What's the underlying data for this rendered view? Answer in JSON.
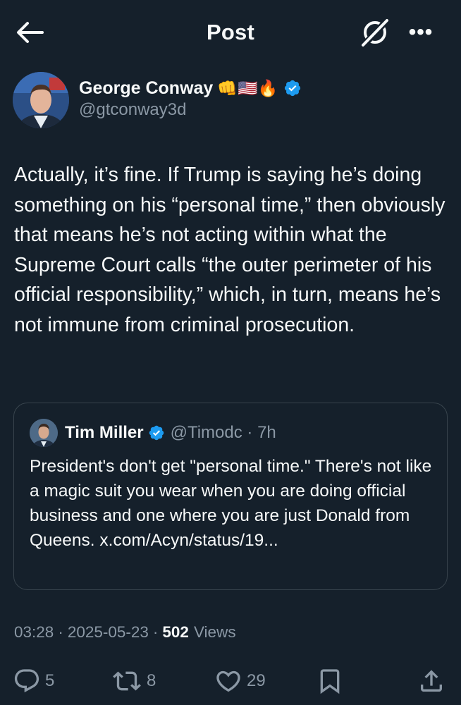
{
  "header": {
    "title": "Post",
    "back_icon": "arrow-left-icon",
    "grok_icon": "grok-icon",
    "more_label": "•••"
  },
  "author": {
    "name": "George Conway",
    "emojis": "👊🇺🇸🔥",
    "handle": "@gtconway3d",
    "verified": true
  },
  "tweet": {
    "text": "Actually, it’s fine. If Trump is saying he’s doing something on his “personal time,” then obviously that means he’s not acting within what the Supreme Court calls “the outer perimeter of his official responsibility,” which, in turn, means he’s not immune from criminal prosecution."
  },
  "quote": {
    "name": "Tim Miller",
    "handle": "@Timodc · 7h",
    "text": "President's don't get \"personal time.\" There's not like a magic suit you wear when you are doing official business and one where you are just Donald from Queens. x.com/Acyn/status/19..."
  },
  "meta": {
    "time": "03:28",
    "date": "2025-05-23",
    "separator": "·",
    "views_count": "502",
    "views_label": "Views"
  },
  "actions": {
    "replies": "5",
    "reposts": "8",
    "likes": "29"
  },
  "colors": {
    "background": "#15202b",
    "text": "#f7f9f9",
    "secondary": "#8b98a5",
    "verified": "#1d9bf0",
    "border": "#38444d"
  }
}
